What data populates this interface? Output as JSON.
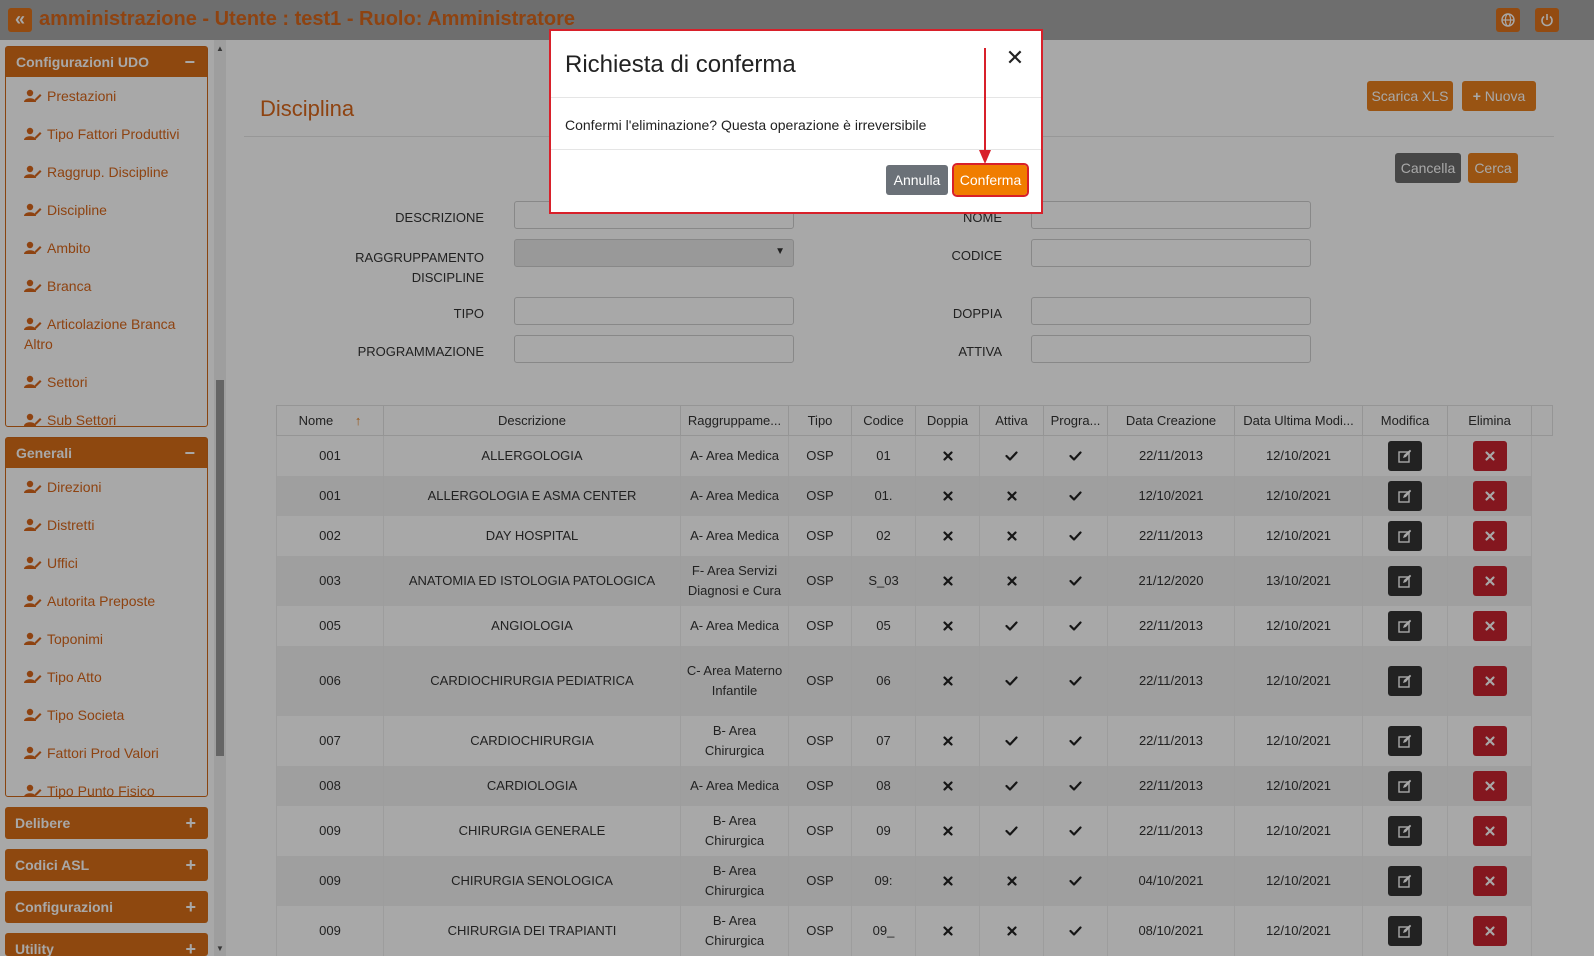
{
  "topbar": {
    "title": "amministrazione - Utente : test1 - Ruolo: Amministratore",
    "back_icon": "double-chevron-left-icon",
    "right_icons": [
      "globe-icon",
      "power-icon"
    ]
  },
  "sidebar": {
    "panels": [
      {
        "title": "Configurazioni UDO",
        "expanded": true,
        "items": [
          "Prestazioni",
          "Tipo Fattori Produttivi",
          "Raggrup. Discipline",
          "Discipline",
          "Ambito",
          "Branca",
          "Articolazione Branca Altro",
          "Settori",
          "Sub Settori"
        ]
      },
      {
        "title": "Generali",
        "expanded": true,
        "items": [
          "Direzioni",
          "Distretti",
          "Uffici",
          "Autorita Preposte",
          "Toponimi",
          "Tipo Atto",
          "Tipo Societa",
          "Fattori Prod Valori",
          "Tipo Punto Fisico"
        ]
      }
    ],
    "collapsed_panels": [
      "Delibere",
      "Codici ASL",
      "Configurazioni",
      "Utility"
    ]
  },
  "page": {
    "title": "Disciplina",
    "buttons": {
      "scarica_xls": "Scarica XLS",
      "nuova": "Nuova",
      "cancella": "Cancella",
      "cerca": "Cerca"
    }
  },
  "filters": {
    "descrizione": {
      "label": "DESCRIZIONE",
      "value": ""
    },
    "raggruppamento": {
      "label_line1": "RAGGRUPPAMENTO",
      "label_line2": "DISCIPLINE",
      "value": ""
    },
    "tipo": {
      "label": "TIPO",
      "value": ""
    },
    "programmazione": {
      "label": "PROGRAMMAZIONE",
      "value": ""
    },
    "nome": {
      "label": "NOME",
      "value": ""
    },
    "codice": {
      "label": "CODICE",
      "value": ""
    },
    "doppia": {
      "label": "DOPPIA",
      "value": ""
    },
    "attiva": {
      "label": "ATTIVA",
      "value": ""
    }
  },
  "table": {
    "columns": [
      "Nome",
      "Descrizione",
      "Raggruppame...",
      "Tipo",
      "Codice",
      "Doppia",
      "Attiva",
      "Progra...",
      "Data Creazione",
      "Data Ultima Modi...",
      "Modifica",
      "Elimina"
    ],
    "sort_indicator": "↑",
    "rows": [
      {
        "nome": "001",
        "descrizione": "ALLERGOLOGIA",
        "raggr": "A- Area Medica",
        "tipo": "OSP",
        "codice": "01",
        "doppia": false,
        "attiva": true,
        "progr": true,
        "creazione": "22/11/2013",
        "modifica": "12/10/2021"
      },
      {
        "nome": "001",
        "descrizione": "ALLERGOLOGIA E ASMA CENTER",
        "raggr": "A- Area Medica",
        "tipo": "OSP",
        "codice": "01.",
        "doppia": false,
        "attiva": false,
        "progr": true,
        "creazione": "12/10/2021",
        "modifica": "12/10/2021"
      },
      {
        "nome": "002",
        "descrizione": "DAY HOSPITAL",
        "raggr": "A- Area Medica",
        "tipo": "OSP",
        "codice": "02",
        "doppia": false,
        "attiva": false,
        "progr": true,
        "creazione": "22/11/2013",
        "modifica": "12/10/2021"
      },
      {
        "nome": "003",
        "descrizione": "ANATOMIA ED ISTOLOGIA PATOLOGICA",
        "raggr": "F- Area Servizi Diagnosi e Cura",
        "tipo": "OSP",
        "codice": "S_03",
        "doppia": false,
        "attiva": false,
        "progr": true,
        "creazione": "21/12/2020",
        "modifica": "13/10/2021"
      },
      {
        "nome": "005",
        "descrizione": "ANGIOLOGIA",
        "raggr": "A- Area Medica",
        "tipo": "OSP",
        "codice": "05",
        "doppia": false,
        "attiva": true,
        "progr": true,
        "creazione": "22/11/2013",
        "modifica": "12/10/2021"
      },
      {
        "nome": "006",
        "descrizione": "CARDIOCHIRURGIA PEDIATRICA",
        "raggr": "C- Area Materno Infantile",
        "tipo": "OSP",
        "codice": "06",
        "doppia": false,
        "attiva": true,
        "progr": true,
        "creazione": "22/11/2013",
        "modifica": "12/10/2021"
      },
      {
        "nome": "007",
        "descrizione": "CARDIOCHIRURGIA",
        "raggr": "B- Area Chirurgica",
        "tipo": "OSP",
        "codice": "07",
        "doppia": false,
        "attiva": true,
        "progr": true,
        "creazione": "22/11/2013",
        "modifica": "12/10/2021"
      },
      {
        "nome": "008",
        "descrizione": "CARDIOLOGIA",
        "raggr": "A- Area Medica",
        "tipo": "OSP",
        "codice": "08",
        "doppia": false,
        "attiva": true,
        "progr": true,
        "creazione": "22/11/2013",
        "modifica": "12/10/2021"
      },
      {
        "nome": "009",
        "descrizione": "CHIRURGIA GENERALE",
        "raggr": "B- Area Chirurgica",
        "tipo": "OSP",
        "codice": "09",
        "doppia": false,
        "attiva": true,
        "progr": true,
        "creazione": "22/11/2013",
        "modifica": "12/10/2021"
      },
      {
        "nome": "009",
        "descrizione": "CHIRURGIA SENOLOGICA",
        "raggr": "B- Area Chirurgica",
        "tipo": "OSP",
        "codice": "09:",
        "doppia": false,
        "attiva": false,
        "progr": true,
        "creazione": "04/10/2021",
        "modifica": "12/10/2021"
      },
      {
        "nome": "009",
        "descrizione": "CHIRURGIA DEI TRAPIANTI",
        "raggr": "B- Area Chirurgica",
        "tipo": "OSP",
        "codice": "09_",
        "doppia": false,
        "attiva": false,
        "progr": true,
        "creazione": "08/10/2021",
        "modifica": "12/10/2021"
      }
    ]
  },
  "modal": {
    "title": "Richiesta di conferma",
    "close_icon": "close-icon",
    "body": "Confermi l'eliminazione? Questa operazione è irreversibile",
    "cancel_label": "Annulla",
    "confirm_label": "Conferma"
  },
  "colors": {
    "accent": "#d86e18",
    "danger": "#c8242f",
    "highlight": "#d8202a"
  }
}
